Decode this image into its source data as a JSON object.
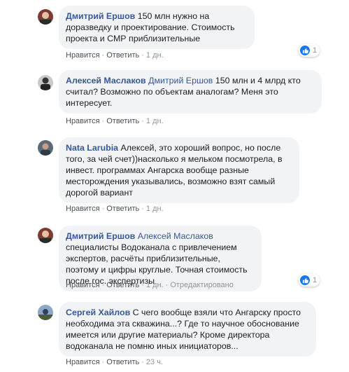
{
  "comments": [
    {
      "author": "Дмитрий Ершов",
      "mention": "",
      "text": "150 млн нужно на доразведку и проектирование. Стоимость проекта и СМР приблизительные",
      "like": "Нравится",
      "reply": "Ответить",
      "time": "1 дн.",
      "edited": "",
      "reactions": "1"
    },
    {
      "author": "Алексей Маслаков",
      "mention": "Дмитрий Ершов",
      "text": "150 млн и 4 млрд кто считал? Возможно по объектам аналогам? Меня это интересует.",
      "like": "Нравится",
      "reply": "Ответить",
      "time": "1 дн.",
      "edited": "",
      "reactions": ""
    },
    {
      "author": "Nata Larubia",
      "mention": "",
      "text": "Алексей, это хороший вопрос, но после того, за чей счет))насколько я мельком посмотрела, в инвест. программах Ангарска вообще разные месторождения указывались, возможно взят самый дорогой вариант",
      "like": "Нравится",
      "reply": "Ответить",
      "time": "1 дн.",
      "edited": "",
      "reactions": ""
    },
    {
      "author": "Дмитрий Ершов",
      "mention": "Алексей Маслаков",
      "text": "специалисты Водоканала с привлечением экспертов, расчёты приблизительные, поэтому и цифры круглые. Точная стоимость после гос. экспертизы",
      "like": "Нравится",
      "reply": "Ответить",
      "time": "1 дн.",
      "edited": "Отредактировано",
      "reactions": "1"
    },
    {
      "author": "Сергей Хайлов",
      "mention": "",
      "text": "С чего вообще взяли что Ангарску просто необходима эта скважина...? Где то научное обоснование имеется или другие материалы? Кроме директора водоканала не помню иных инициаторов...",
      "like": "Нравится",
      "reply": "Ответить",
      "time": "23 ч.",
      "edited": "",
      "reactions": ""
    }
  ],
  "colors": {
    "name": "#385898",
    "bubble": "#f2f3f5",
    "meta": "#90949c",
    "like_badge": "#1877f2"
  }
}
